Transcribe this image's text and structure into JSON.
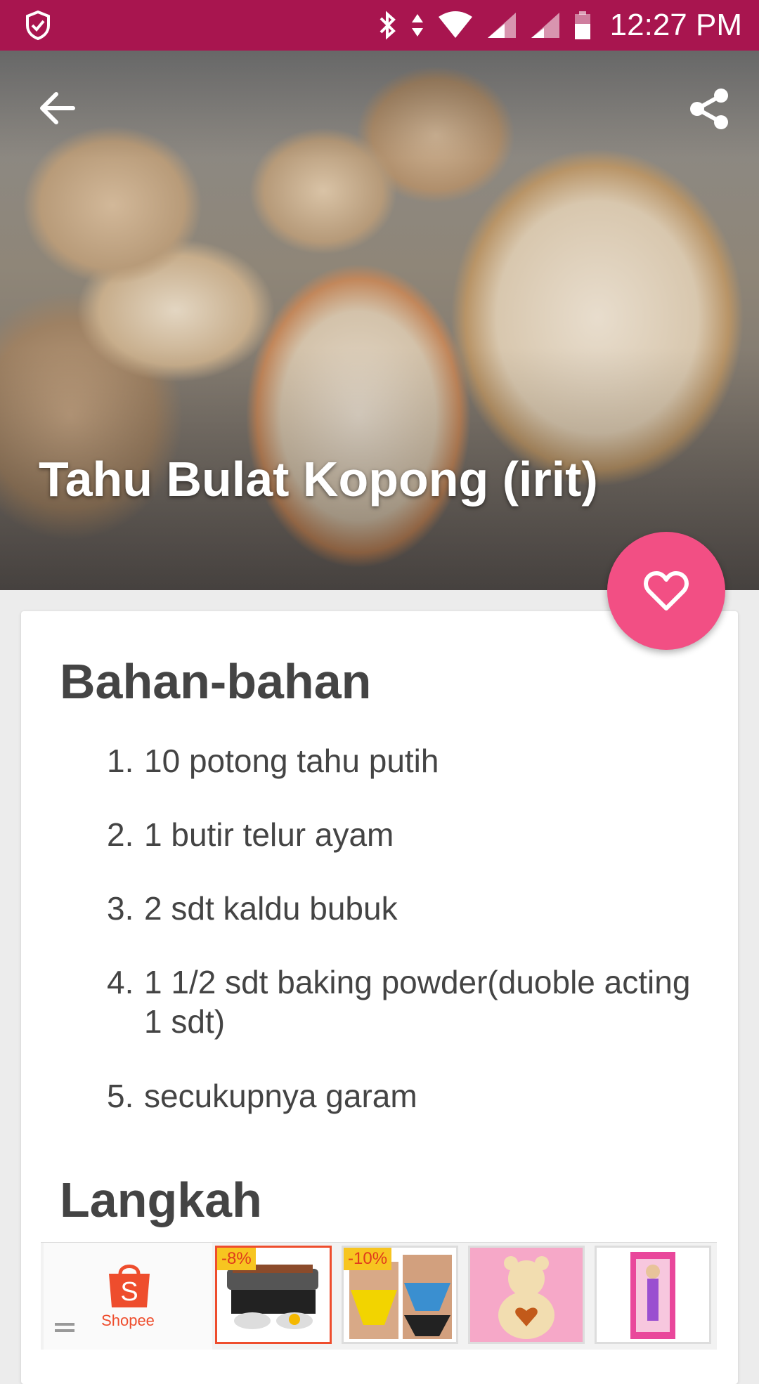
{
  "status_bar": {
    "time": "12:27 PM",
    "icons": [
      "shield-check-icon",
      "bluetooth-icon",
      "data-arrows-icon",
      "wifi-icon",
      "signal-icon",
      "signal-icon",
      "battery-icon"
    ]
  },
  "colors": {
    "status_bar": "#a8154f",
    "fab": "#f24f84",
    "shopee": "#ee4d2d",
    "text": "#444444"
  },
  "hero": {
    "title": "Tahu Bulat Kopong (irit)",
    "back_icon": "arrow-back-icon",
    "share_icon": "share-icon"
  },
  "fab": {
    "icon": "heart-outline-icon"
  },
  "ingredients_section": {
    "title": "Bahan-bahan",
    "items": [
      {
        "num": "1.",
        "text": "10 potong tahu putih"
      },
      {
        "num": "2.",
        "text": "1 butir telur ayam"
      },
      {
        "num": "3.",
        "text": "2 sdt kaldu bubuk"
      },
      {
        "num": "4.",
        "text": "1 1/2 sdt baking powder(duoble acting 1 sdt)"
      },
      {
        "num": "5.",
        "text": "secukupnya garam"
      }
    ]
  },
  "steps_section": {
    "title": "Langkah"
  },
  "ad": {
    "brand_label": "Shopee",
    "products": [
      {
        "badge": "-8%",
        "icon": "grill-product-image"
      },
      {
        "badge": "-10%",
        "icon": "underwear-product-image"
      },
      {
        "badge": "",
        "icon": "teddy-bear-product-image"
      },
      {
        "badge": "",
        "icon": "doll-product-image"
      }
    ]
  }
}
